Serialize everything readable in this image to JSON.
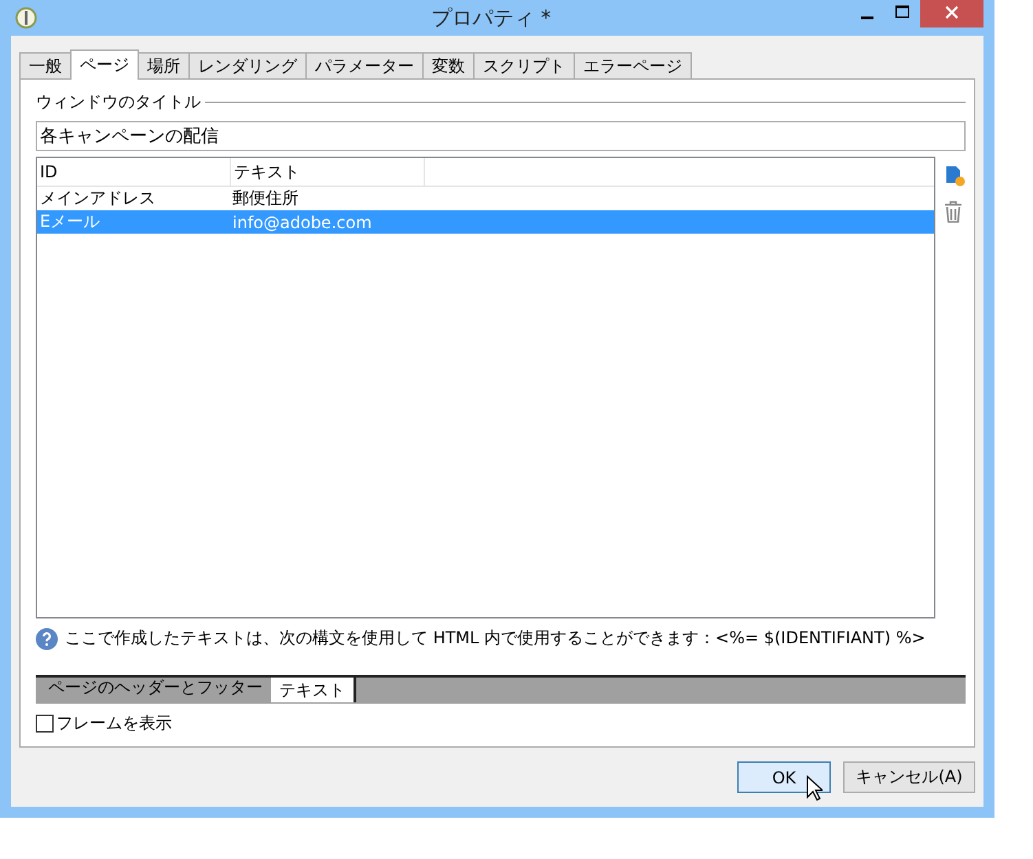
{
  "window": {
    "title": "プロパティ *"
  },
  "tabs": [
    {
      "label": "一般",
      "selected": false
    },
    {
      "label": "ページ",
      "selected": true
    },
    {
      "label": "場所",
      "selected": false
    },
    {
      "label": "レンダリング",
      "selected": false
    },
    {
      "label": "パラメーター",
      "selected": false
    },
    {
      "label": "変数",
      "selected": false
    },
    {
      "label": "スクリプト",
      "selected": false
    },
    {
      "label": "エラーページ",
      "selected": false
    }
  ],
  "title_group": {
    "label": "ウィンドウのタイトル",
    "value": "各キャンペーンの配信"
  },
  "table": {
    "columns": [
      "ID",
      "テキスト"
    ],
    "rows": [
      {
        "cells": [
          "メインアドレス",
          "郵便住所"
        ],
        "selected": false
      },
      {
        "cells": [
          "Eメール",
          "info@adobe.com"
        ],
        "selected": true
      }
    ]
  },
  "hint": "ここで作成したテキストは、次の構文を使用して HTML 内で使用することができます：<%= $(IDENTIFIANT) %>",
  "bottom_tabs": [
    {
      "label": "ページのヘッダーとフッター",
      "selected": false
    },
    {
      "label": "テキスト",
      "selected": true
    }
  ],
  "show_frame": {
    "label": "フレームを表示",
    "checked": false
  },
  "buttons": [
    {
      "label": "OK",
      "default": true
    },
    {
      "label": "キャンセル(A)",
      "default": false
    }
  ]
}
